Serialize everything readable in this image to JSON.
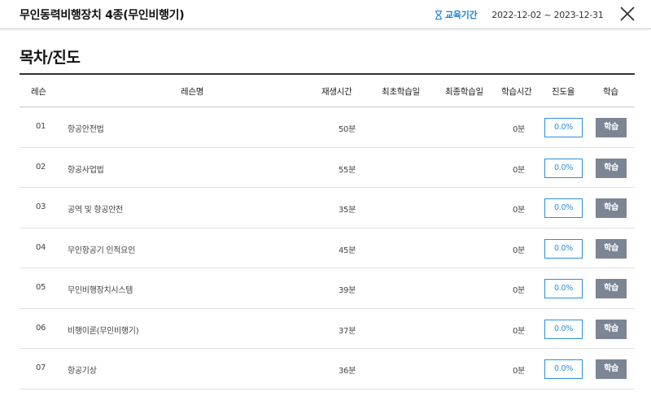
{
  "header": {
    "title": "무인동력비행장치 4종(무인비행기)",
    "period_label": "교육기간",
    "period_dates": "2022-12-02 ~ 2023-12-31"
  },
  "section": {
    "title": "목차/진도"
  },
  "table": {
    "columns": {
      "lesson": "레슨",
      "name": "레슨명",
      "playtime": "재생시간",
      "first_study": "최초학습일",
      "last_study": "최종학습일",
      "study_time": "학습시간",
      "progress": "진도율",
      "study": "학습"
    },
    "rows": [
      {
        "num": "01",
        "name": "항공안전법",
        "playtime": "50분",
        "first": "",
        "last": "",
        "study_time": "0분",
        "progress": "0.0%",
        "button": "학습"
      },
      {
        "num": "02",
        "name": "항공사업법",
        "playtime": "55분",
        "first": "",
        "last": "",
        "study_time": "0분",
        "progress": "0.0%",
        "button": "학습"
      },
      {
        "num": "03",
        "name": "공역 및 항공안전",
        "playtime": "35분",
        "first": "",
        "last": "",
        "study_time": "0분",
        "progress": "0.0%",
        "button": "학습"
      },
      {
        "num": "04",
        "name": "무인항공기 인적요인",
        "playtime": "45분",
        "first": "",
        "last": "",
        "study_time": "0분",
        "progress": "0.0%",
        "button": "학습"
      },
      {
        "num": "05",
        "name": "무인비행장치시스템",
        "playtime": "39분",
        "first": "",
        "last": "",
        "study_time": "0분",
        "progress": "0.0%",
        "button": "학습"
      },
      {
        "num": "06",
        "name": "비행이론(무인비행기)",
        "playtime": "37분",
        "first": "",
        "last": "",
        "study_time": "0분",
        "progress": "0.0%",
        "button": "학습"
      },
      {
        "num": "07",
        "name": "항공기상",
        "playtime": "36분",
        "first": "",
        "last": "",
        "study_time": "0분",
        "progress": "0.0%",
        "button": "학습"
      }
    ]
  },
  "icons": {
    "period": "hourglass-icon",
    "close": "close-icon"
  },
  "colors": {
    "accent": "#1c7fd6",
    "progress_border": "#2b8fe0",
    "button_bg": "#7b8594"
  }
}
